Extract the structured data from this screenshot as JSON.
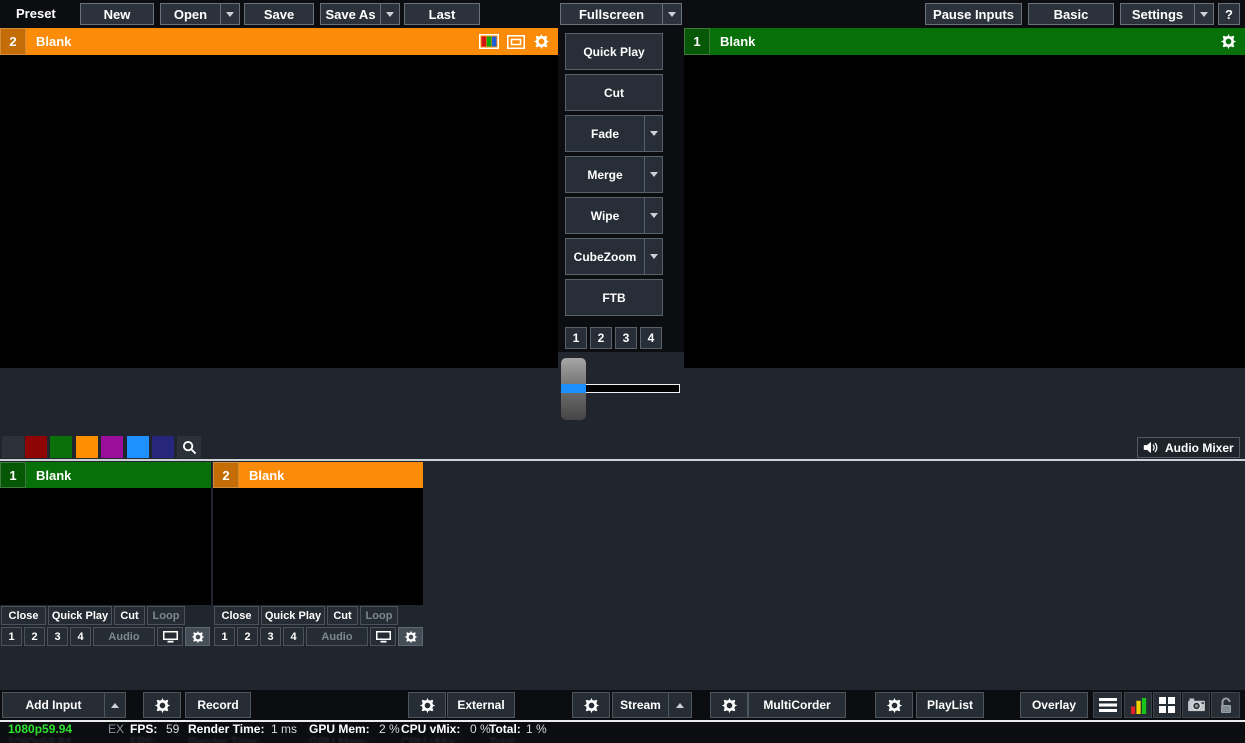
{
  "top_toolbar": {
    "preset_label": "Preset",
    "new": "New",
    "open": "Open",
    "save": "Save",
    "save_as": "Save As",
    "last": "Last",
    "fullscreen": "Fullscreen",
    "pause_inputs": "Pause Inputs",
    "basic": "Basic",
    "settings": "Settings",
    "help": "?"
  },
  "preview_window": {
    "number": "2",
    "title": "Blank"
  },
  "program_window": {
    "number": "1",
    "title": "Blank"
  },
  "transitions": {
    "buttons": [
      {
        "label": "Quick Play",
        "has_dropdown": false
      },
      {
        "label": "Cut",
        "has_dropdown": false
      },
      {
        "label": "Fade",
        "has_dropdown": true
      },
      {
        "label": "Merge",
        "has_dropdown": true
      },
      {
        "label": "Wipe",
        "has_dropdown": true
      },
      {
        "label": "CubeZoom",
        "has_dropdown": true
      },
      {
        "label": "FTB",
        "has_dropdown": false
      }
    ],
    "overlay_numbers": [
      "1",
      "2",
      "3",
      "4"
    ]
  },
  "quick_bar": {
    "swatch_colors": [
      "#2c323a",
      "#8f0505",
      "#0a700a",
      "#ff8e00",
      "#990f99",
      "#1e90ff",
      "#26267c"
    ],
    "audio_mixer_label": "Audio Mixer"
  },
  "inputs": [
    {
      "number": "1",
      "title": "Blank",
      "buttons": {
        "close": "Close",
        "quick_play": "Quick Play",
        "cut": "Cut",
        "loop": "Loop",
        "numbers": [
          "1",
          "2",
          "3",
          "4"
        ],
        "audio": "Audio"
      }
    },
    {
      "number": "2",
      "title": "Blank",
      "buttons": {
        "close": "Close",
        "quick_play": "Quick Play",
        "cut": "Cut",
        "loop": "Loop",
        "numbers": [
          "1",
          "2",
          "3",
          "4"
        ],
        "audio": "Audio"
      }
    }
  ],
  "bottom_toolbar": {
    "add_input": "Add Input",
    "record": "Record",
    "external": "External",
    "stream": "Stream",
    "multicorder": "MultiCorder",
    "playlist": "PlayList",
    "overlay": "Overlay"
  },
  "status_bar": {
    "resolution": "1080p59.94",
    "ex": "EX",
    "fps_label": "FPS:",
    "fps_value": "59",
    "render_label": "Render Time:",
    "render_value": "1 ms",
    "gpu_label": "GPU Mem:",
    "gpu_value": "2 %",
    "cpu_label": "CPU vMix:",
    "cpu_value": "0 %",
    "total_label": "Total:",
    "total_value": "1 %"
  },
  "colors": {
    "preview_accent": "#fb8c0a",
    "program_accent": "#087008",
    "tbar_blue": "#1e8fff",
    "status_green": "#2ee52e"
  },
  "icons": {
    "gear": "⚙",
    "monitor": "🖵",
    "color_bars": "▦",
    "speaker": "🔊",
    "search": "🔍",
    "menu": "≡",
    "audio_meter": "▮",
    "grid_view": "▦",
    "camera": "📷",
    "lock_open": "🔓",
    "dropdown_down": "▾",
    "dropdown_up": "▴"
  }
}
